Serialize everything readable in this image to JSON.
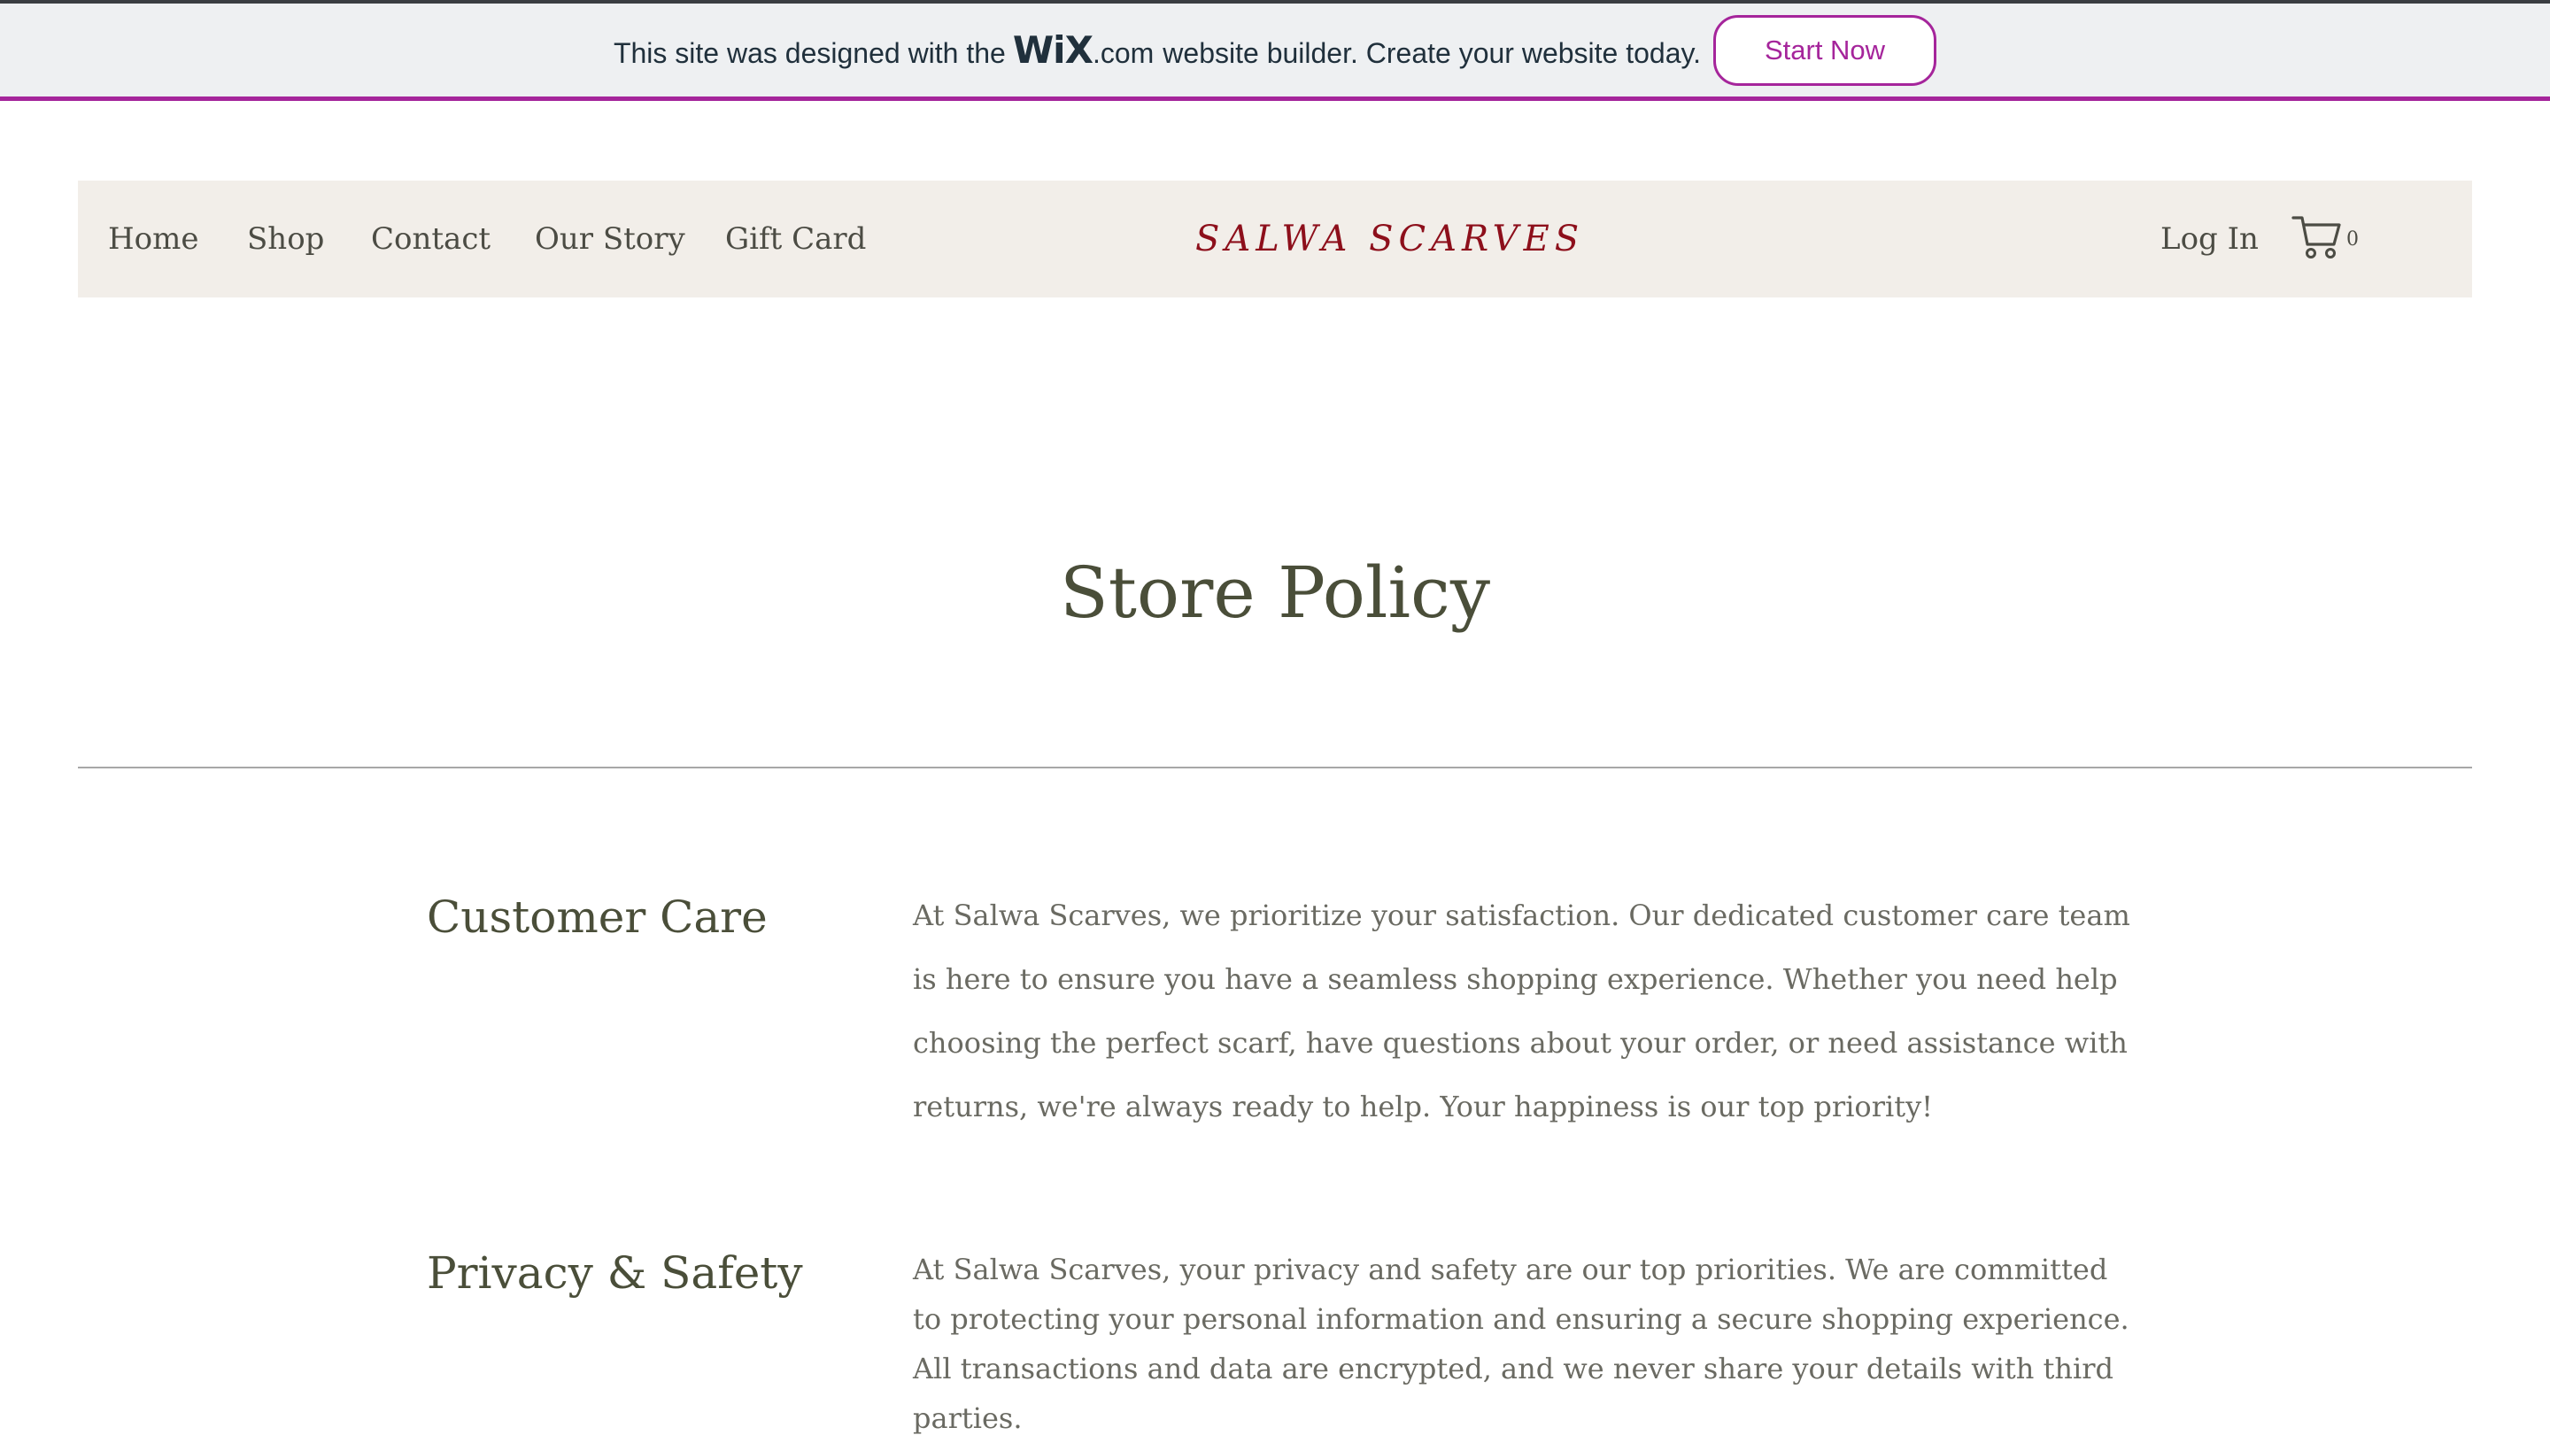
{
  "wix_banner": {
    "text_before": "This site was designed with the",
    "logo": "WiX",
    "dotcom": ".com",
    "text_after": "website builder. Create your website today.",
    "cta": "Start Now"
  },
  "header": {
    "nav": [
      "Home",
      "Shop",
      "Contact",
      "Our Story",
      "Gift Card"
    ],
    "brand": "SALWA SCARVES",
    "login": "Log In",
    "cart_icon": "shopping-cart-icon",
    "cart_count": "0"
  },
  "main": {
    "title": "Store Policy",
    "sections": [
      {
        "heading": "Customer Care",
        "body": "At Salwa Scarves, we prioritize your satisfaction. Our dedicated customer care team is here to ensure you have a seamless shopping experience. Whether you need help choosing the perfect scarf, have questions about your order, or need assistance with returns, we're always ready to help. Your happiness is our top priority!"
      },
      {
        "heading": "Privacy & Safety",
        "body": "At Salwa Scarves, your privacy and safety are our top priorities. We are committed to protecting your personal information and ensuring a secure shopping experience. All transactions and data are encrypted, and we never share your details with third parties."
      }
    ]
  },
  "colors": {
    "banner_accent": "#a5259b",
    "brand": "#8d0f1b",
    "header_bg": "#f2eee9",
    "heading_text": "#4a4e39",
    "body_text": "#6a6a62"
  }
}
